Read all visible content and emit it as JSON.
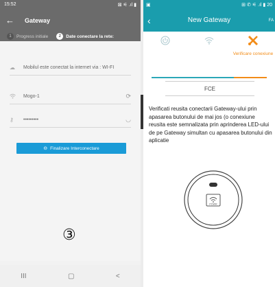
{
  "left_screen": {
    "status_bar": {
      "time": "15:52",
      "icons": "⊠ ⚟ .ıl ▮"
    },
    "app_bar": {
      "title": "Gateway",
      "back_icon": "arrow-left-icon"
    },
    "steps": [
      {
        "number": "1",
        "label": "Progress initiale",
        "active": false
      },
      {
        "number": "2",
        "label": "Date conectare la rete:",
        "active": true
      }
    ],
    "rows": [
      {
        "icon": "cloud-icon",
        "text": "Mobilul este conectat la internet via : WI-FI",
        "right": ""
      },
      {
        "icon": "wifi-icon",
        "text": "Mogo-1",
        "right": "⟳"
      },
      {
        "icon": "key-icon",
        "text": "•••••••••",
        "right": "◡"
      }
    ],
    "finalize_button": {
      "label": "Finalizare Interconectare"
    },
    "step_marker": "③",
    "nav_bar": {
      "recents": "III",
      "home": "▢",
      "back": "<"
    }
  },
  "right_screen": {
    "status_bar": {
      "time": "20",
      "icons": "⊞ ✆ ⚟ .ıl ▮"
    },
    "app_bar": {
      "title": "New Gateway",
      "extra": "FA"
    },
    "tabs": [
      {
        "icon": "power-icon",
        "label": ""
      },
      {
        "icon": "wifi-icon",
        "label": ""
      },
      {
        "icon": "tools-icon",
        "label": "Verificare conexiune"
      }
    ],
    "code": "FCE",
    "description": "Verificati reusita conectarii Gateway-ului prin apasarea butonului de mai jos (o conexiune reusita este semnalizata prin aprinderea LED-ului de pe Gateway simultan cu apasarea butonului din aplicatie",
    "device_label": "POWR"
  },
  "colors": {
    "left_header": "#6b6b6b",
    "right_header": "#1a9dad",
    "accent_orange": "#f28c18",
    "button_blue": "#1a9bd7"
  }
}
